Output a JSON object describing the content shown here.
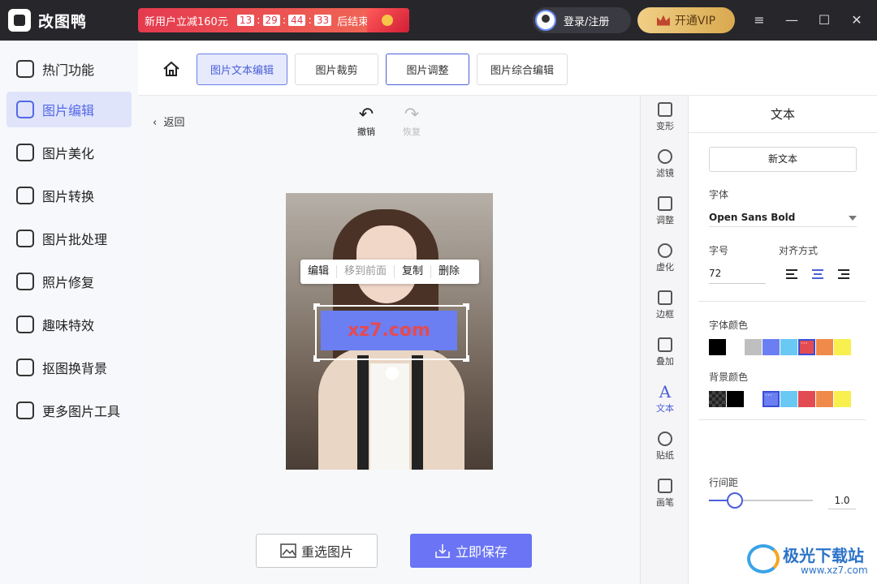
{
  "app": {
    "name": "改图鸭"
  },
  "promo": {
    "text": "新用户立减160元",
    "countdown": [
      "13",
      "29",
      "44",
      "33"
    ],
    "suffix": "后结束"
  },
  "header": {
    "login_label": "登录/注册",
    "vip_label": "开通VIP",
    "menu_icon": "≡",
    "minimize_icon": "—",
    "maximize_icon": "☐",
    "close_icon": "✕"
  },
  "sidebar": {
    "items": [
      {
        "label": "热门功能",
        "icon": "fire-icon"
      },
      {
        "label": "图片编辑",
        "icon": "image-edit-icon",
        "active": true
      },
      {
        "label": "图片美化",
        "icon": "image-beautify-icon"
      },
      {
        "label": "图片转换",
        "icon": "convert-icon"
      },
      {
        "label": "图片批处理",
        "icon": "batch-icon"
      },
      {
        "label": "照片修复",
        "icon": "repair-icon"
      },
      {
        "label": "趣味特效",
        "icon": "magic-icon"
      },
      {
        "label": "抠图换背景",
        "icon": "cutout-icon"
      },
      {
        "label": "更多图片工具",
        "icon": "toolbox-icon"
      }
    ]
  },
  "tabs": [
    {
      "label": "图片文本编辑",
      "active": true
    },
    {
      "label": "图片裁剪"
    },
    {
      "label": "图片调整"
    },
    {
      "label": "图片综合编辑"
    }
  ],
  "editor": {
    "back_label": "返回",
    "undo_label": "撤销",
    "redo_label": "恢复",
    "context_menu": [
      "编辑",
      "移到前面",
      "复制",
      "删除"
    ],
    "text_content": "xz7.com",
    "reselect_label": "重选图片",
    "save_label": "立即保存"
  },
  "tools": [
    {
      "label": "变形",
      "icon": "transform-icon"
    },
    {
      "label": "滤镜",
      "icon": "filter-icon"
    },
    {
      "label": "调整",
      "icon": "adjust-icon"
    },
    {
      "label": "虚化",
      "icon": "blur-icon"
    },
    {
      "label": "边框",
      "icon": "border-icon"
    },
    {
      "label": "叠加",
      "icon": "overlay-icon"
    },
    {
      "label": "文本",
      "icon": "text-icon",
      "active": true
    },
    {
      "label": "贴纸",
      "icon": "sticker-icon"
    },
    {
      "label": "画笔",
      "icon": "brush-icon"
    }
  ],
  "panel": {
    "title": "文本",
    "new_text_label": "新文本",
    "font_label": "字体",
    "font_value": "Open Sans Bold",
    "size_label": "字号",
    "size_value": "72",
    "align_label": "对齐方式",
    "font_color_label": "字体颜色",
    "font_colors": [
      "#000000",
      "#ffffff",
      "#bfbfbf",
      "#6b7ff2",
      "#6ac8f5",
      "#e34b52",
      "#f08a4b",
      "#f7f04f"
    ],
    "font_color_selected": 5,
    "bg_color_label": "背景颜色",
    "bg_colors": [
      "transparent",
      "#000000",
      "#ffffff",
      "#6b7ff2",
      "#6ac8f5",
      "#e34b52",
      "#f08a4b",
      "#f7f04f"
    ],
    "bg_color_selected": 3,
    "line_spacing_label": "行间距",
    "line_spacing_value": "1.0"
  },
  "watermark": {
    "title": "极光下载站",
    "url": "www.xz7.com"
  }
}
